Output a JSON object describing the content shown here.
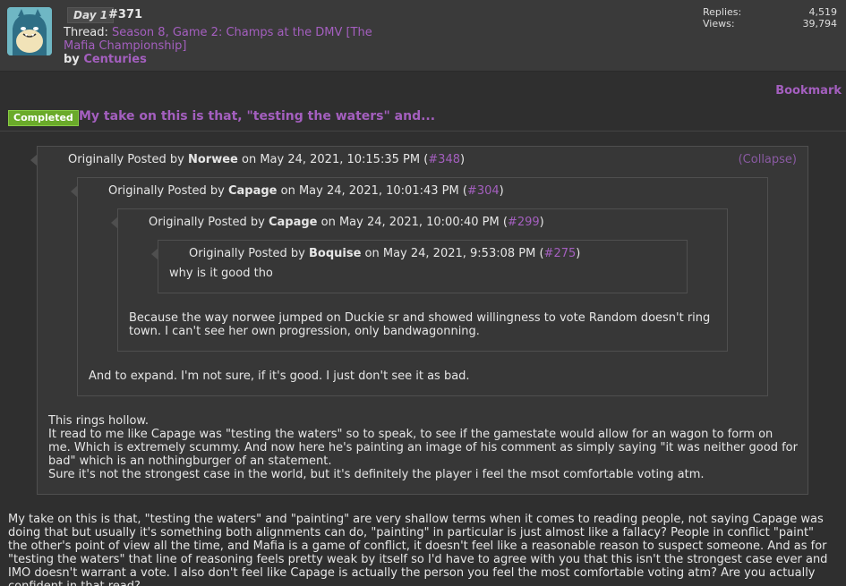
{
  "header": {
    "day_tag": "Day 1",
    "post_number": "#371",
    "thread_label": "Thread:",
    "thread_title": "Season 8, Game 2: Champs at the DMV [The Mafia Championship]",
    "by_label": "by",
    "author": "Centuries",
    "stats": {
      "replies_label": "Replies:",
      "replies_value": "4,519",
      "views_label": "Views:",
      "views_value": "39,794"
    }
  },
  "bookmark_label": "Bookmark",
  "post": {
    "status_badge": "Completed",
    "title": "My take on this is that, \"testing the waters\" and...",
    "collapse_label": "(Collapse)",
    "quotes": [
      {
        "prefix": "Originally Posted by",
        "author": "Norwee",
        "date": "on May 24, 2021, 10:15:35 PM (",
        "ref": "#348",
        "suffix": ")",
        "body": [
          "This rings hollow.",
          "It read to me like Capage was \"testing the waters\" so to speak, to see if the gamestate would allow for an wagon to form on me. Which is extremely scummy. And now here he's painting an image of his comment as simply saying \"it was neither good for bad\" which is an nothingburger of an statement.",
          "Sure it's not the strongest case in the world, but it's definitely the player i feel the msot comfortable voting atm."
        ]
      },
      {
        "prefix": "Originally Posted by",
        "author": "Capage",
        "date": "on May 24, 2021, 10:01:43 PM (",
        "ref": "#304",
        "suffix": ")",
        "body": [
          "And to expand. I'm not sure, if it's good. I just don't see it as bad."
        ]
      },
      {
        "prefix": "Originally Posted by",
        "author": "Capage",
        "date": "on May 24, 2021, 10:00:40 PM (",
        "ref": "#299",
        "suffix": ")",
        "body": [
          "Because the way norwee jumped on Duckie sr and showed willingness to vote Random doesn't ring town. I can't see her own progression, only bandwagonning."
        ]
      },
      {
        "prefix": "Originally Posted by",
        "author": "Boquise",
        "date": "on May 24, 2021, 9:53:08 PM (",
        "ref": "#275",
        "suffix": ")",
        "body": [
          "why is it good tho"
        ]
      }
    ],
    "main_text": "My take on this is that, \"testing the waters\" and \"painting\" are very shallow terms when it comes to reading people, not saying Capage was doing that but usually it's something both alignments can do, \"painting\" in particular is just almost like a fallacy? People in conflict \"paint\" the other's point of view all the time, and Mafia is a game of conflict, it doesn't feel like a reasonable reason to suspect someone. And as for \"testing the waters\" that line of reasoning feels pretty weak by itself so I'd have to agree with you that this isn't the strongest case ever and IMO doesn't warrant a vote. I also don't feel like Capage is actually the person you feel the most comfortable voting atm? Are you actually confident in that read?"
  },
  "colors": {
    "background": "#2f2f2f",
    "header_bg": "#3a3a3a",
    "quote_bg": "#373737",
    "quote_border": "#4f4f4f",
    "link": "#a45fbf",
    "badge_green": "#6aaa2a"
  }
}
